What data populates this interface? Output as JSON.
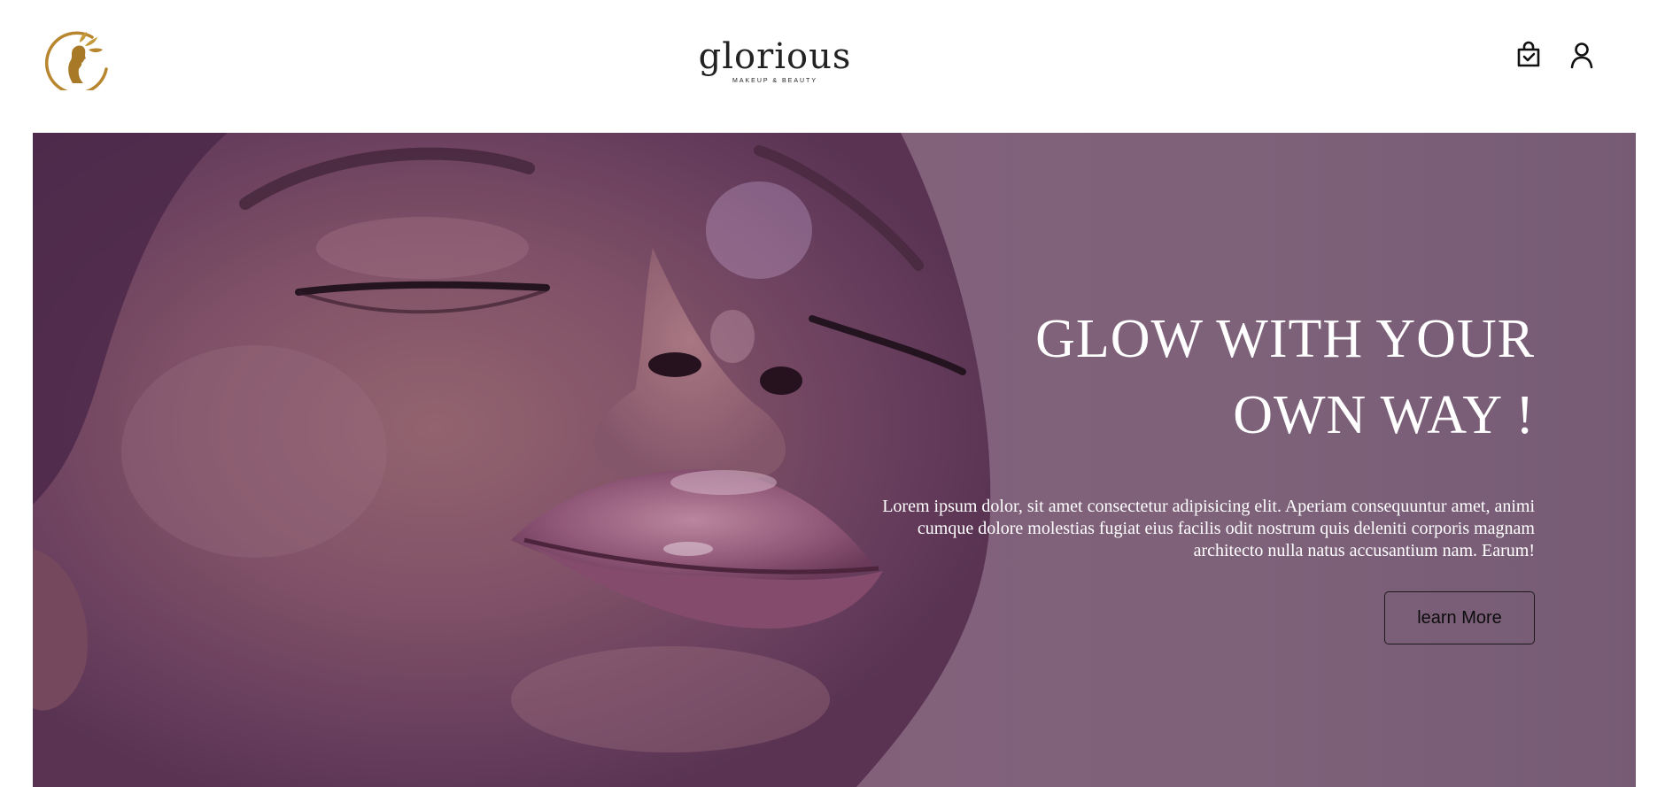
{
  "header": {
    "logo_icon": "woman-profile-leaf-emblem-icon",
    "brand_name": "glorious",
    "brand_tagline": "MAKEUP & BEAUTY",
    "cart_icon": "shopping-bag-icon",
    "user_icon": "user-icon"
  },
  "hero": {
    "title_line1": "GLOW WITH YOUR",
    "title_line2": "OWN WAY !",
    "description": "Lorem ipsum dolor, sit amet consectetur adipisicing elit. Aperiam consequuntur amet, animi cumque dolore molestias fugiat eius facilis odit nostrum quis deleniti corporis magnam architecto nulla natus accusantium nam. Earum!",
    "button_label": "learn More",
    "background_image": "woman-face-closeup-photo"
  },
  "colors": {
    "accent_gold": "#b8862e",
    "hero_purple": "#866a80",
    "text_white": "#ffffff",
    "text_dark": "#1a1a1a"
  }
}
